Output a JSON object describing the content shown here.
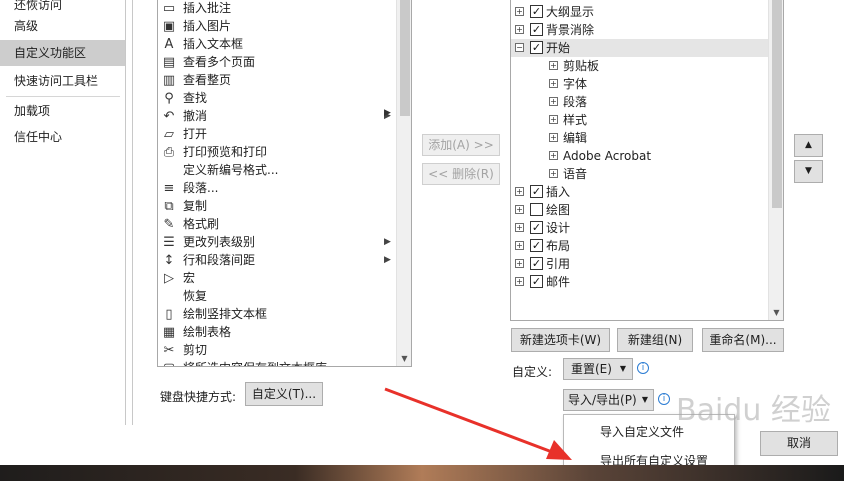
{
  "left_nav": {
    "items": [
      {
        "label": "还恢访问"
      },
      {
        "label": "高级"
      },
      {
        "label": "自定义功能区"
      },
      {
        "label": "快速访问工具栏"
      },
      {
        "label": "加载项"
      },
      {
        "label": "信任中心"
      }
    ]
  },
  "commands": {
    "items": [
      {
        "icon": "insert-comment-icon",
        "label": "插入批注",
        "has_submenu": false
      },
      {
        "icon": "insert-picture-icon",
        "label": "插入图片",
        "has_submenu": false
      },
      {
        "icon": "insert-textbox-icon",
        "label": "插入文本框",
        "has_submenu": false
      },
      {
        "icon": "multiple-pages-icon",
        "label": "查看多个页面",
        "has_submenu": false
      },
      {
        "icon": "whole-page-icon",
        "label": "查看整页",
        "has_submenu": false
      },
      {
        "icon": "find-icon",
        "label": "查找",
        "has_submenu": false
      },
      {
        "icon": "undo-icon",
        "label": "撤消",
        "has_submenu": true
      },
      {
        "icon": "open-icon",
        "label": "打开",
        "has_submenu": false
      },
      {
        "icon": "print-preview-icon",
        "label": "打印预览和打印",
        "has_submenu": false
      },
      {
        "icon": "none",
        "label": "定义新编号格式...",
        "has_submenu": false
      },
      {
        "icon": "paragraph-icon",
        "label": "段落...",
        "has_submenu": false
      },
      {
        "icon": "copy-icon",
        "label": "复制",
        "has_submenu": false
      },
      {
        "icon": "format-painter-icon",
        "label": "格式刷",
        "has_submenu": false
      },
      {
        "icon": "change-list-level-icon",
        "label": "更改列表级别",
        "has_submenu": true
      },
      {
        "icon": "line-spacing-icon",
        "label": "行和段落间距",
        "has_submenu": true
      },
      {
        "icon": "macro-icon",
        "label": "宏",
        "has_submenu": false
      },
      {
        "icon": "none",
        "label": "恢复",
        "has_submenu": false
      },
      {
        "icon": "vertical-textbox-icon",
        "label": "绘制竖排文本框",
        "has_submenu": false
      },
      {
        "icon": "draw-table-icon",
        "label": "绘制表格",
        "has_submenu": false
      },
      {
        "icon": "cut-icon",
        "label": "剪切",
        "has_submenu": false
      },
      {
        "icon": "save-selection-icon",
        "label": "将所选内容保存到文本框库",
        "has_submenu": false
      }
    ]
  },
  "add_button": {
    "label": "添加(A) >>"
  },
  "remove_button": {
    "label": "<< 删除(R)"
  },
  "keyboard": {
    "label": "键盘快捷方式:",
    "button": "自定义(T)..."
  },
  "ribbon_tree": {
    "rows": [
      {
        "level": 0,
        "expander": "+",
        "checkbox": true,
        "label": "大纲显示",
        "checked": true,
        "selected": false
      },
      {
        "level": 0,
        "expander": "+",
        "checkbox": true,
        "label": "背景消除",
        "checked": true,
        "selected": false
      },
      {
        "level": 0,
        "expander": "−",
        "checkbox": true,
        "label": "开始",
        "checked": true,
        "selected": true
      },
      {
        "level": 1,
        "expander": "+",
        "checkbox": false,
        "label": "剪贴板",
        "checked": false,
        "selected": false
      },
      {
        "level": 1,
        "expander": "+",
        "checkbox": false,
        "label": "字体",
        "checked": false,
        "selected": false
      },
      {
        "level": 1,
        "expander": "+",
        "checkbox": false,
        "label": "段落",
        "checked": false,
        "selected": false
      },
      {
        "level": 1,
        "expander": "+",
        "checkbox": false,
        "label": "样式",
        "checked": false,
        "selected": false
      },
      {
        "level": 1,
        "expander": "+",
        "checkbox": false,
        "label": "编辑",
        "checked": false,
        "selected": false
      },
      {
        "level": 1,
        "expander": "+",
        "checkbox": false,
        "label": "Adobe Acrobat",
        "checked": false,
        "selected": false
      },
      {
        "level": 1,
        "expander": "+",
        "checkbox": false,
        "label": "语音",
        "checked": false,
        "selected": false
      },
      {
        "level": 0,
        "expander": "+",
        "checkbox": true,
        "label": "插入",
        "checked": true,
        "selected": false
      },
      {
        "level": 0,
        "expander": "+",
        "checkbox": true,
        "label": "绘图",
        "checked": false,
        "selected": false
      },
      {
        "level": 0,
        "expander": "+",
        "checkbox": true,
        "label": "设计",
        "checked": true,
        "selected": false
      },
      {
        "level": 0,
        "expander": "+",
        "checkbox": true,
        "label": "布局",
        "checked": true,
        "selected": false
      },
      {
        "level": 0,
        "expander": "+",
        "checkbox": true,
        "label": "引用",
        "checked": true,
        "selected": false
      },
      {
        "level": 0,
        "expander": "+",
        "checkbox": true,
        "label": "邮件",
        "checked": true,
        "selected": false
      }
    ]
  },
  "tree_buttons": {
    "new_tab": "新建选项卡(W)",
    "new_group": "新建组(N)",
    "rename": "重命名(M)..."
  },
  "customize": {
    "label": "自定义:",
    "reset": "重置(E)",
    "import_export": "导入/导出(P)"
  },
  "menu": {
    "items": [
      {
        "label": "导入自定义文件"
      },
      {
        "label": "导出所有自定义设置"
      }
    ]
  },
  "cancel_button": {
    "label": "取消"
  },
  "watermark": {
    "text": "Baidu 经验"
  },
  "colors": {
    "accent": "#2b7cd3",
    "selected_nav": "#cdcdcd",
    "arrow": "#e8312a"
  }
}
